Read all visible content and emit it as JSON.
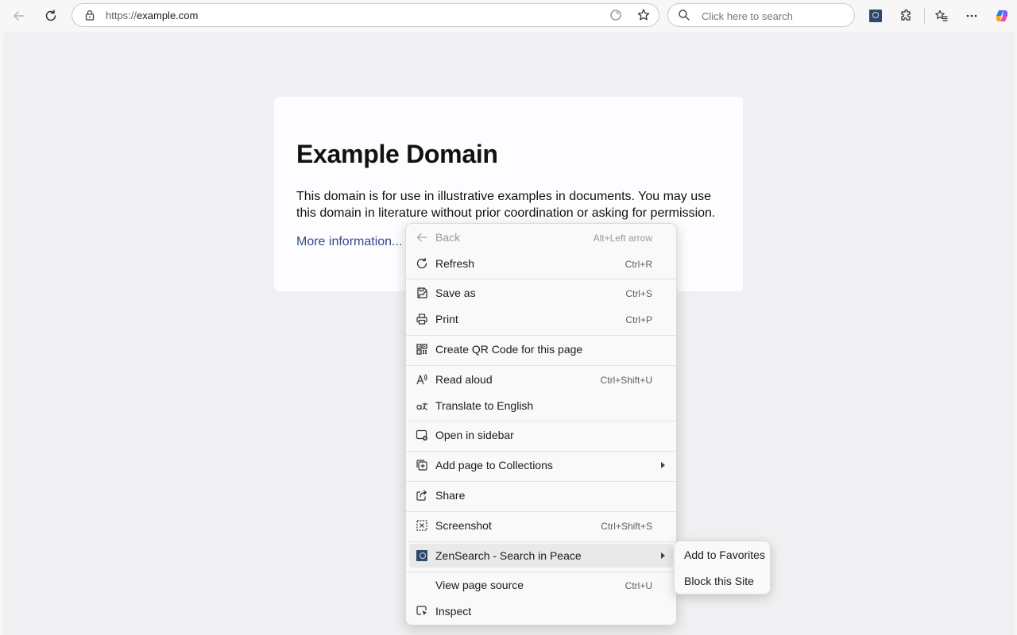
{
  "colors": {
    "toolbar_bg": "#f7f7f7",
    "page_bg": "#f0f0f2",
    "card_bg": "#fdfdff",
    "link": "#38488f",
    "menu_bg": "#f9f9f9",
    "menu_hover": "#e9e9e9",
    "zensearch_badge": "#2d4a6b"
  },
  "toolbar": {
    "back_icon": "arrow-left-icon",
    "refresh_icon": "refresh-icon",
    "address": {
      "lock_icon": "lock-icon",
      "url_protocol": "https://",
      "url_host": "example.com",
      "readaloud_icon": "edge-refresh-icon",
      "favorite_icon": "star-icon"
    },
    "search": {
      "placeholder": "Click here to search",
      "icon": "search-icon"
    },
    "extensions": [
      "zensearch-icon",
      "puzzle-icon",
      "favorites-icon",
      "more-icon",
      "copilot-icon"
    ]
  },
  "page": {
    "title": "Example Domain",
    "body": "This domain is for use in illustrative examples in documents. You may use this domain in literature without prior coordination or asking for permission.",
    "link_text": "More information..."
  },
  "context_menu": {
    "items": [
      {
        "label": "Back",
        "shortcut": "Alt+Left arrow",
        "icon": "arrow-left-icon",
        "disabled": true
      },
      {
        "label": "Refresh",
        "shortcut": "Ctrl+R",
        "icon": "refresh-icon"
      },
      {
        "label": "Save as",
        "shortcut": "Ctrl+S",
        "icon": "save-icon"
      },
      {
        "label": "Print",
        "shortcut": "Ctrl+P",
        "icon": "print-icon"
      },
      {
        "label": "Create QR Code for this page",
        "shortcut": "",
        "icon": "qr-code-icon"
      },
      {
        "label": "Read aloud",
        "shortcut": "Ctrl+Shift+U",
        "icon": "read-aloud-icon"
      },
      {
        "label": "Translate to English",
        "shortcut": "",
        "icon": "translate-icon"
      },
      {
        "label": "Open in sidebar",
        "shortcut": "",
        "icon": "sidebar-icon"
      },
      {
        "label": "Add page to Collections",
        "shortcut": "",
        "icon": "collections-icon",
        "submenu": true
      },
      {
        "label": "Share",
        "shortcut": "",
        "icon": "share-icon"
      },
      {
        "label": "Screenshot",
        "shortcut": "Ctrl+Shift+S",
        "icon": "screenshot-icon"
      },
      {
        "label": "ZenSearch - Search in Peace",
        "shortcut": "",
        "icon": "zensearch-icon",
        "submenu": true,
        "hover": true
      },
      {
        "label": "View page source",
        "shortcut": "Ctrl+U",
        "icon": ""
      },
      {
        "label": "Inspect",
        "shortcut": "",
        "icon": "inspect-icon"
      }
    ]
  },
  "submenu": {
    "items": [
      {
        "label": "Add to Favorites"
      },
      {
        "label": "Block this Site"
      }
    ]
  }
}
